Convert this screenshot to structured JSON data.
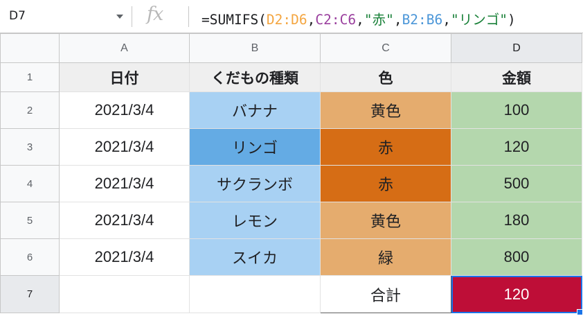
{
  "name_box": {
    "value": "D7"
  },
  "formula": {
    "icon": "fx-icon",
    "tokens": [
      {
        "text": "=SUMIFS(",
        "color": "#202124"
      },
      {
        "text": "D2:D6",
        "color": "#f4a641"
      },
      {
        "text": ",",
        "color": "#202124"
      },
      {
        "text": "C2:C6",
        "color": "#9a3f9e"
      },
      {
        "text": ",",
        "color": "#202124"
      },
      {
        "text": "\"赤\"",
        "color": "#188038"
      },
      {
        "text": ",",
        "color": "#202124"
      },
      {
        "text": "B2:B6",
        "color": "#4b96d8"
      },
      {
        "text": ",",
        "color": "#202124"
      },
      {
        "text": "\"リンゴ\"",
        "color": "#188038"
      },
      {
        "text": ")",
        "color": "#202124"
      }
    ]
  },
  "columns": [
    "A",
    "B",
    "C",
    "D"
  ],
  "row_numbers": [
    "1",
    "2",
    "3",
    "4",
    "5",
    "6",
    "7"
  ],
  "header": [
    "日付",
    "くだもの種類",
    "色",
    "金額"
  ],
  "rows": [
    [
      "2021/3/4",
      "バナナ",
      "黄色",
      "100"
    ],
    [
      "2021/3/4",
      "リンゴ",
      "赤",
      "120"
    ],
    [
      "2021/3/4",
      "サクランボ",
      "赤",
      "500"
    ],
    [
      "2021/3/4",
      "レモン",
      "黄色",
      "180"
    ],
    [
      "2021/3/4",
      "スイカ",
      "緑",
      "800"
    ]
  ],
  "total": {
    "label": "合計",
    "value": "120"
  },
  "colors": {
    "active_outline": "#1a73e8",
    "total_fill": "#be0e37",
    "fruit_light": "#a8d1f3",
    "fruit_highlight": "#64abe4",
    "color_light": "#e5ac6e",
    "color_highlight": "#d66d15",
    "amount_fill": "#b4d7ad"
  }
}
